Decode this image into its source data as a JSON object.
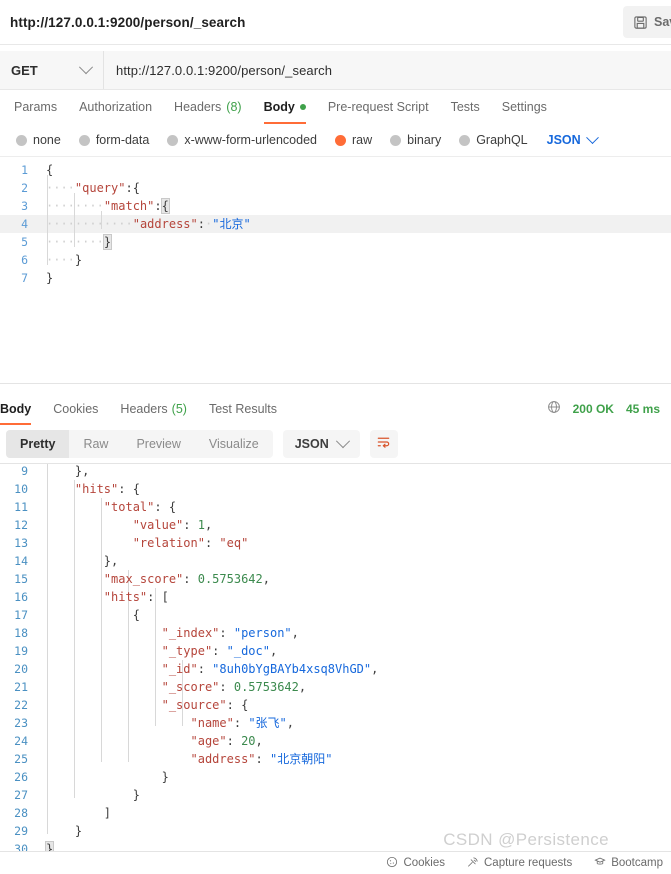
{
  "window": {
    "tab_title": "http://127.0.0.1:9200/person/_search",
    "save_label": "Save"
  },
  "request": {
    "method": "GET",
    "url": "http://127.0.0.1:9200/person/_search",
    "tabs": [
      {
        "label": "Params",
        "active": false,
        "count": "",
        "dot": false
      },
      {
        "label": "Authorization",
        "active": false,
        "count": "",
        "dot": false
      },
      {
        "label": "Headers",
        "active": false,
        "count": "(8)",
        "dot": false
      },
      {
        "label": "Body",
        "active": true,
        "count": "",
        "dot": true
      },
      {
        "label": "Pre-request Script",
        "active": false,
        "count": "",
        "dot": false
      },
      {
        "label": "Tests",
        "active": false,
        "count": "",
        "dot": false
      },
      {
        "label": "Settings",
        "active": false,
        "count": "",
        "dot": false
      }
    ],
    "body_types": [
      {
        "label": "none",
        "selected": false
      },
      {
        "label": "form-data",
        "selected": false
      },
      {
        "label": "x-www-form-urlencoded",
        "selected": false
      },
      {
        "label": "raw",
        "selected": true
      },
      {
        "label": "binary",
        "selected": false
      },
      {
        "label": "GraphQL",
        "selected": false
      }
    ],
    "format_selected": "JSON",
    "body_lines": [
      {
        "no": "1",
        "text": "{"
      },
      {
        "no": "2",
        "text": "    \"query\":{"
      },
      {
        "no": "3",
        "text": "        \"match\":{"
      },
      {
        "no": "4",
        "text": "            \"address\": \"北京\""
      },
      {
        "no": "5",
        "text": "        }"
      },
      {
        "no": "6",
        "text": "    }"
      },
      {
        "no": "7",
        "text": "}"
      }
    ]
  },
  "response": {
    "tabs": [
      {
        "label": "Body",
        "active": true,
        "count": ""
      },
      {
        "label": "Cookies",
        "active": false,
        "count": ""
      },
      {
        "label": "Headers",
        "active": false,
        "count": "(5)"
      },
      {
        "label": "Test Results",
        "active": false,
        "count": ""
      }
    ],
    "status": "200 OK",
    "time": "45 ms",
    "view_modes": [
      {
        "label": "Pretty",
        "active": true
      },
      {
        "label": "Raw",
        "active": false
      },
      {
        "label": "Preview",
        "active": false
      },
      {
        "label": "Visualize",
        "active": false
      }
    ],
    "format_selected": "JSON",
    "body_lines": [
      {
        "no": "9",
        "text": "    },",
        "cut": true
      },
      {
        "no": "10",
        "text": "    \"hits\": {"
      },
      {
        "no": "11",
        "text": "        \"total\": {"
      },
      {
        "no": "12",
        "text": "            \"value\": 1,"
      },
      {
        "no": "13",
        "text": "            \"relation\": \"eq\""
      },
      {
        "no": "14",
        "text": "        },"
      },
      {
        "no": "15",
        "text": "        \"max_score\": 0.5753642,"
      },
      {
        "no": "16",
        "text": "        \"hits\": ["
      },
      {
        "no": "17",
        "text": "            {"
      },
      {
        "no": "18",
        "text": "                \"_index\": \"person\","
      },
      {
        "no": "19",
        "text": "                \"_type\": \"_doc\","
      },
      {
        "no": "20",
        "text": "                \"_id\": \"8uh0bYgBAYb4xsq8VhGD\","
      },
      {
        "no": "21",
        "text": "                \"_score\": 0.5753642,"
      },
      {
        "no": "22",
        "text": "                \"_source\": {"
      },
      {
        "no": "23",
        "text": "                    \"name\": \"张飞\","
      },
      {
        "no": "24",
        "text": "                    \"age\": 20,"
      },
      {
        "no": "25",
        "text": "                    \"address\": \"北京朝阳\""
      },
      {
        "no": "26",
        "text": "                }"
      },
      {
        "no": "27",
        "text": "            }"
      },
      {
        "no": "28",
        "text": "        ]"
      },
      {
        "no": "29",
        "text": "    }"
      },
      {
        "no": "30",
        "text": "}"
      }
    ]
  },
  "statusbar": {
    "items": [
      {
        "label": "Cookies",
        "icon": "cookie-icon"
      },
      {
        "label": "Capture requests",
        "icon": "satellite-icon"
      },
      {
        "label": "Bootcamp",
        "icon": "bootcamp-icon"
      }
    ]
  },
  "watermark": "CSDN @Persistence",
  "colors": {
    "accent": "#ff6c37",
    "success": "#3fa14a",
    "link": "#1668dc",
    "key": "#b5453b",
    "string": "#1668dc",
    "number": "#3c8a4e"
  }
}
